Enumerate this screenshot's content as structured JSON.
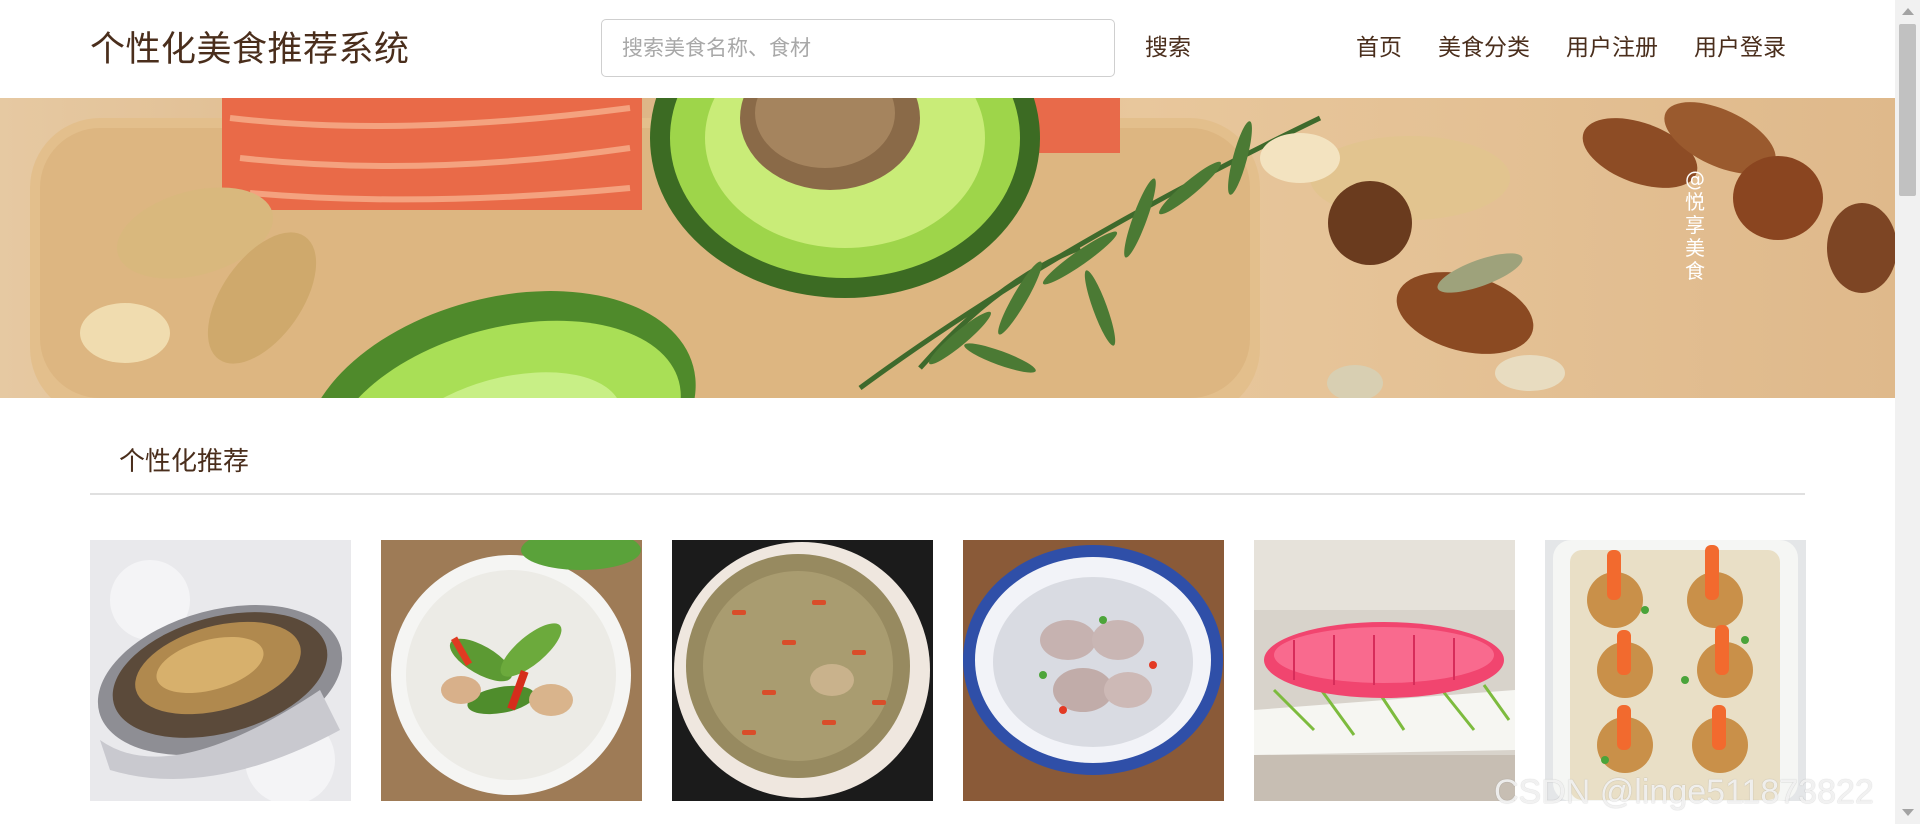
{
  "header": {
    "brand": "个性化美食推荐系统",
    "search_placeholder": "搜索美食名称、食材",
    "search_value": "",
    "search_button": "搜索",
    "nav": [
      "首页",
      "美食分类",
      "用户注册",
      "用户登录"
    ]
  },
  "banner": {
    "watermark": [
      "@",
      "悦",
      "享",
      "美",
      "食"
    ]
  },
  "section": {
    "title": "个性化推荐"
  },
  "dishes": [
    {
      "icon": "baked-oyster-image"
    },
    {
      "icon": "bitter-melon-pork-image"
    },
    {
      "icon": "goji-soup-image"
    },
    {
      "icon": "pork-trotter-soup-image"
    },
    {
      "icon": "pink-corn-dish-image"
    },
    {
      "icon": "garlic-shrimp-vermicelli-image"
    }
  ],
  "footer_watermark": "CSDN @linge511873822",
  "colors": {
    "brand_text": "#4a2e1c",
    "divider": "#e0e0e0",
    "search_border": "#cfcfcf"
  }
}
